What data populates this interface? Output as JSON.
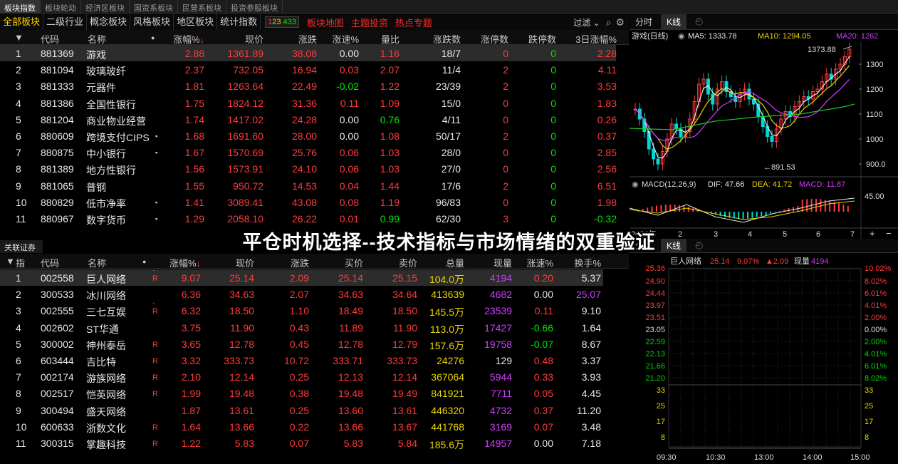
{
  "top_tabs": [
    "板块指数",
    "板块轮动",
    "经济区板块",
    "国资系板块",
    "民营系板块",
    "投资参股板块"
  ],
  "categories": [
    "全部板块",
    "二级行业",
    "概念板块",
    "风格板块",
    "地区板块",
    "统计指数"
  ],
  "count_badge": {
    "a": "1",
    "b": "23",
    "c": "433"
  },
  "links": [
    "板块地图",
    "主题投资",
    "热点专题"
  ],
  "filter_label": "过滤",
  "sector_table": {
    "headers": [
      "代码",
      "名称",
      "涨幅%",
      "现价",
      "涨跌",
      "涨速%",
      "量比",
      "涨跌数",
      "涨停数",
      "跌停数",
      "3日涨幅%"
    ],
    "rows": [
      {
        "i": "1",
        "code": "881369",
        "name": "游戏",
        "mark": "",
        "pct": "2.88",
        "price": "1361.89",
        "chg": "38.08",
        "spd": "0.00",
        "vr": "1.16",
        "ud": "18/7",
        "lu": "0",
        "ld": "0",
        "d3": "2.28"
      },
      {
        "i": "2",
        "code": "881094",
        "name": "玻璃玻纤",
        "mark": "",
        "pct": "2.37",
        "price": "732.05",
        "chg": "16.94",
        "spd": "0.03",
        "vr": "2.07",
        "ud": "11/4",
        "lu": "2",
        "ld": "0",
        "d3": "4.11"
      },
      {
        "i": "3",
        "code": "881333",
        "name": "元器件",
        "mark": "",
        "pct": "1.81",
        "price": "1263.64",
        "chg": "22.49",
        "spd": "-0.02",
        "vr": "1.22",
        "ud": "23/39",
        "lu": "2",
        "ld": "0",
        "d3": "3.53"
      },
      {
        "i": "4",
        "code": "881386",
        "name": "全国性银行",
        "mark": "",
        "pct": "1.75",
        "price": "1824.12",
        "chg": "31.36",
        "spd": "0.11",
        "vr": "1.09",
        "ud": "15/0",
        "lu": "0",
        "ld": "0",
        "d3": "1.83"
      },
      {
        "i": "5",
        "code": "881204",
        "name": "商业物业经营",
        "mark": "",
        "pct": "1.74",
        "price": "1417.02",
        "chg": "24.28",
        "spd": "0.00",
        "vr": "0.76",
        "ud": "4/11",
        "lu": "0",
        "ld": "0",
        "d3": "0.26"
      },
      {
        "i": "6",
        "code": "880609",
        "name": "跨境支付CIPS",
        "mark": "▪",
        "pct": "1.68",
        "price": "1691.60",
        "chg": "28.00",
        "spd": "0.00",
        "vr": "1.08",
        "ud": "50/17",
        "lu": "2",
        "ld": "0",
        "d3": "0.37"
      },
      {
        "i": "7",
        "code": "880875",
        "name": "中小银行",
        "mark": "▪",
        "pct": "1.67",
        "price": "1570.69",
        "chg": "25.76",
        "spd": "0.06",
        "vr": "1.03",
        "ud": "28/0",
        "lu": "0",
        "ld": "0",
        "d3": "2.85"
      },
      {
        "i": "8",
        "code": "881389",
        "name": "地方性银行",
        "mark": "",
        "pct": "1.56",
        "price": "1573.91",
        "chg": "24.10",
        "spd": "0.06",
        "vr": "1.03",
        "ud": "27/0",
        "lu": "0",
        "ld": "0",
        "d3": "2.56"
      },
      {
        "i": "9",
        "code": "881065",
        "name": "普钢",
        "mark": "",
        "pct": "1.55",
        "price": "950.72",
        "chg": "14.53",
        "spd": "0.04",
        "vr": "1.44",
        "ud": "17/6",
        "lu": "2",
        "ld": "0",
        "d3": "6.51"
      },
      {
        "i": "10",
        "code": "880829",
        "name": "低市净率",
        "mark": "▪",
        "pct": "1.41",
        "price": "3089.41",
        "chg": "43.08",
        "spd": "0.08",
        "vr": "1.19",
        "ud": "96/83",
        "lu": "0",
        "ld": "0",
        "d3": "1.98"
      },
      {
        "i": "11",
        "code": "880967",
        "name": "数字货币",
        "mark": "▪",
        "pct": "1.29",
        "price": "2058.10",
        "chg": "26.22",
        "spd": "0.01",
        "vr": "0.99",
        "ud": "62/30",
        "lu": "3",
        "ld": "0",
        "d3": "-0.32"
      }
    ]
  },
  "section2_title": "关联证券",
  "stock_table": {
    "index_header": "指",
    "headers": [
      "代码",
      "名称",
      "涨幅%",
      "现价",
      "涨跌",
      "买价",
      "卖价",
      "总量",
      "现量",
      "涨速%",
      "换手%"
    ],
    "rows": [
      {
        "i": "1",
        "code": "002558",
        "name": "巨人网络",
        "r": "R",
        "pct": "9.07",
        "price": "25.14",
        "chg": "2.09",
        "bid": "25.14",
        "ask": "25.15",
        "vol": "104.0万",
        "cur": "4194",
        "spd": "0.20",
        "to": "5.37"
      },
      {
        "i": "2",
        "code": "300533",
        "name": "冰川网络",
        "r": "",
        "pct": "6.36",
        "price": "34.63",
        "chg": "2.07",
        "bid": "34.63",
        "ask": "34.64",
        "vol": "413639",
        "cur": "4682",
        "spd": "0.00",
        "to": "25.07"
      },
      {
        "i": "3",
        "code": "002555",
        "name": "三七互娱",
        "r": "R",
        "pct": "6.32",
        "price": "18.50",
        "chg": "1.10",
        "bid": "18.49",
        "ask": "18.50",
        "vol": "145.5万",
        "cur": "23539",
        "spd": "0.11",
        "to": "9.10"
      },
      {
        "i": "4",
        "code": "002602",
        "name": "ST华通",
        "r": "",
        "pct": "3.75",
        "price": "11.90",
        "chg": "0.43",
        "bid": "11.89",
        "ask": "11.90",
        "vol": "113.0万",
        "cur": "17427",
        "spd": "-0.66",
        "to": "1.64"
      },
      {
        "i": "5",
        "code": "300002",
        "name": "神州泰岳",
        "r": "R",
        "pct": "3.65",
        "price": "12.78",
        "chg": "0.45",
        "bid": "12.78",
        "ask": "12.79",
        "vol": "157.6万",
        "cur": "19758",
        "spd": "-0.07",
        "to": "8.67"
      },
      {
        "i": "6",
        "code": "603444",
        "name": "吉比特",
        "r": "R",
        "pct": "3.32",
        "price": "333.73",
        "chg": "10.72",
        "bid": "333.71",
        "ask": "333.73",
        "vol": "24276",
        "cur": "129",
        "spd": "0.48",
        "to": "3.37"
      },
      {
        "i": "7",
        "code": "002174",
        "name": "游族网络",
        "r": "R",
        "pct": "2.10",
        "price": "12.14",
        "chg": "0.25",
        "bid": "12.13",
        "ask": "12.14",
        "vol": "367064",
        "cur": "5944",
        "spd": "0.33",
        "to": "3.93"
      },
      {
        "i": "8",
        "code": "002517",
        "name": "恺英网络",
        "r": "R",
        "pct": "1.99",
        "price": "19.48",
        "chg": "0.38",
        "bid": "19.48",
        "ask": "19.49",
        "vol": "841921",
        "cur": "7711",
        "spd": "0.05",
        "to": "4.45"
      },
      {
        "i": "9",
        "code": "300494",
        "name": "盛天网络",
        "r": "",
        "pct": "1.87",
        "price": "13.61",
        "chg": "0.25",
        "bid": "13.60",
        "ask": "13.61",
        "vol": "446320",
        "cur": "4732",
        "spd": "0.37",
        "to": "11.20"
      },
      {
        "i": "10",
        "code": "600633",
        "name": "浙数文化",
        "r": "R",
        "pct": "1.64",
        "price": "13.66",
        "chg": "0.22",
        "bid": "13.66",
        "ask": "13.67",
        "vol": "441768",
        "cur": "3169",
        "spd": "0.07",
        "to": "3.48"
      },
      {
        "i": "11",
        "code": "300315",
        "name": "掌趣科技",
        "r": "R",
        "pct": "1.22",
        "price": "5.83",
        "chg": "0.07",
        "bid": "5.83",
        "ask": "5.84",
        "vol": "185.6万",
        "cur": "14957",
        "spd": "0.00",
        "to": "7.18"
      }
    ]
  },
  "kline_panel": {
    "tab_fenshi": "分时",
    "tab_kline": "K线",
    "title": "游戏(日线)",
    "ma5": "MA5: 1333.78",
    "ma10": "MA10: 1294.05",
    "ma20": "MA20: 1262",
    "high_label": "1373.88",
    "low_label": "891.53",
    "yaxis": [
      "1300",
      "1200",
      "1100",
      "1000",
      "900.0"
    ],
    "macd_title": "MACD(12,26,9)",
    "dif": "DIF: 47.66",
    "dea": "DEA: 41.72",
    "macd": "MACD: 11.87",
    "macd_axis": "45.00",
    "xaxis": [
      "2024年",
      "2",
      "3",
      "4",
      "5",
      "6",
      "7"
    ]
  },
  "minute_panel": {
    "tab_fenshi": "分时",
    "tab_kline": "K线",
    "name": "巨人网络",
    "price": "25.14",
    "pct": "9.07%",
    "chg": "▲2.09",
    "vol_label": "现量",
    "vol": "4194",
    "left_axis": [
      "25.36",
      "24.90",
      "24.44",
      "23.97",
      "23.51",
      "23.05",
      "22.59",
      "22.13",
      "21.66",
      "21.20"
    ],
    "right_axis": [
      "10.02%",
      "8.02%",
      "6.01%",
      "4.01%",
      "2.00%",
      "0.00%",
      "2.00%",
      "4.01%",
      "6.01%",
      "8.02%"
    ],
    "vol_axis": [
      "33",
      "25",
      "17",
      "8"
    ],
    "time_axis": [
      "09:30",
      "10:30",
      "13:00",
      "14:00",
      "15:00"
    ]
  },
  "overlay_title": "平仓时机选择--技术指标与市场情绪的双重验证",
  "colors": {
    "up": "#ff3b3b",
    "down": "#00e600",
    "accent": "#ffd200",
    "bg": "#000000"
  }
}
